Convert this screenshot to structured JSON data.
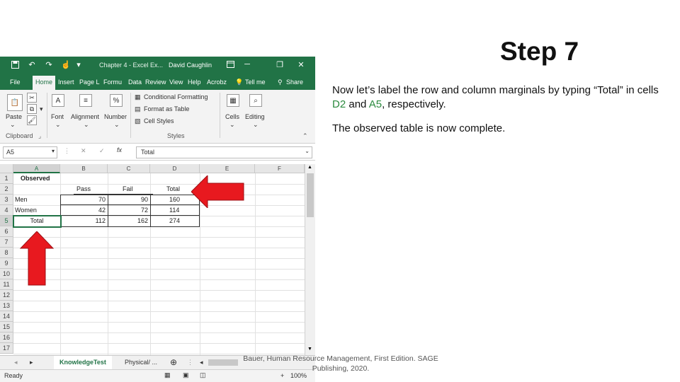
{
  "slide": {
    "title": "Step 7",
    "paragraph1": {
      "before": "Now let’s label the row and column marginals by typing “Total” in cells ",
      "cell1": "D2",
      "mid": " and ",
      "cell2": "A5",
      "after": ", respectively."
    },
    "paragraph2": "The observed table is now complete.",
    "footer": "Bauer, Human Resource Management, First Edition. SAGE Publishing, 2020.",
    "highlight_color": "#2b8a3e",
    "arrow_color": "#e8191f"
  },
  "excel": {
    "title_file": "Chapter 4 - Excel Ex...",
    "user": "David Caughlin",
    "tabs": [
      "File",
      "Home",
      "Insert",
      "Page L",
      "Formu",
      "Data",
      "Review",
      "View",
      "Help",
      "Acrobz"
    ],
    "active_tab": "Home",
    "tell_me": "Tell me",
    "share": "Share",
    "ribbon": {
      "paste": "Paste",
      "clipboard": "Clipboard",
      "font": "Font",
      "alignment": "Alignment",
      "number": "Number",
      "conditional": "Conditional Formatting",
      "format_table": "Format as Table",
      "cell_styles": "Cell Styles",
      "styles": "Styles",
      "cells": "Cells",
      "editing": "Editing"
    },
    "name_box": "A5",
    "formula": "Total",
    "columns": [
      "A",
      "B",
      "C",
      "D",
      "E",
      "F"
    ],
    "active_column": "A",
    "rows": [
      "1",
      "2",
      "3",
      "4",
      "5",
      "6",
      "7",
      "8",
      "9",
      "10",
      "11",
      "12",
      "13",
      "14",
      "15",
      "16",
      "17"
    ],
    "active_row": "5",
    "cells": {
      "A1": "Observed",
      "B2": "Pass",
      "C2": "Fail",
      "D2": "Total",
      "A3": "Men",
      "B3": "70",
      "C3": "90",
      "D3": "160",
      "A4": "Women",
      "B4": "42",
      "C4": "72",
      "D4": "114",
      "A5": "Total",
      "B5": "112",
      "C5": "162",
      "D5": "274"
    },
    "sheets": [
      "KnowledgeTest",
      "Physical/ ..."
    ],
    "active_sheet": "KnowledgeTest",
    "status": "Ready",
    "zoom": "100%"
  }
}
